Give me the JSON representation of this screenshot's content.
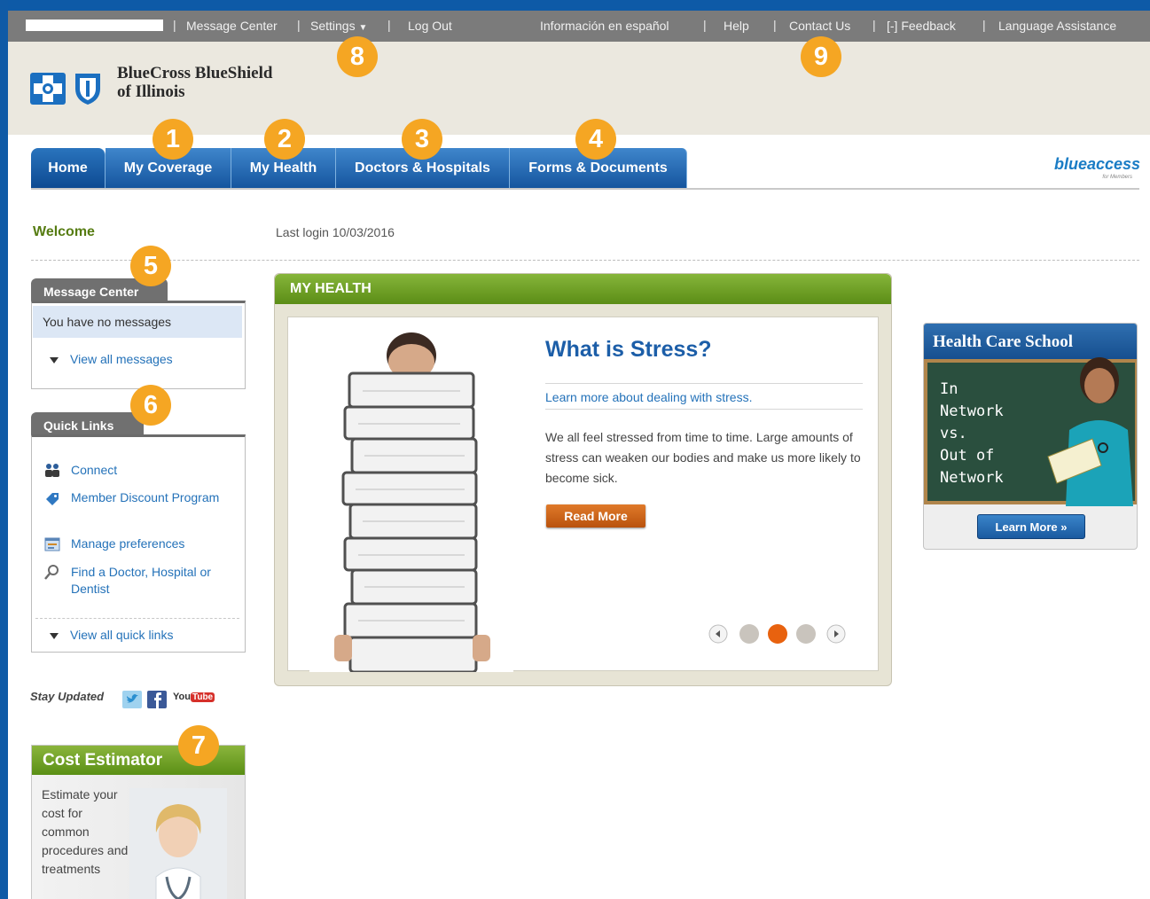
{
  "topbar": {
    "items": [
      "Message Center",
      "Settings",
      "Log Out",
      "Información en español",
      "Help",
      "Contact Us",
      "[-] Feedback",
      "Language Assistance"
    ]
  },
  "brand": {
    "line1": "BlueCross BlueShield",
    "line2": "of Illinois"
  },
  "nav": {
    "tabs": [
      "Home",
      "My Coverage",
      "My Health",
      "Doctors & Hospitals",
      "Forms & Documents"
    ]
  },
  "blueaccess": {
    "logo": "blueaccess",
    "sub": "for Members"
  },
  "welcome": {
    "label": "Welcome",
    "last_login": "Last login 10/03/2016"
  },
  "message_center": {
    "title": "Message Center",
    "status": "You have no messages",
    "view_all": "View all messages"
  },
  "quick_links": {
    "title": "Quick Links",
    "items": [
      {
        "label": "Connect",
        "icon": "people-icon"
      },
      {
        "label": "Member Discount Program",
        "icon": "tag-icon"
      },
      {
        "label": "Manage preferences",
        "icon": "settings-window-icon"
      },
      {
        "label": "Find a Doctor, Hospital or Dentist",
        "icon": "magnifier-icon"
      }
    ],
    "view_all": "View all quick links"
  },
  "social": {
    "label": "Stay Updated",
    "youtube": "YouTube"
  },
  "cost_estimator": {
    "title": "Cost Estimator",
    "text": "Estimate your cost for common procedures and treatments"
  },
  "my_health": {
    "header": "MY HEALTH",
    "title": "What is Stress?",
    "link": "Learn more about dealing with stress.",
    "body": "We all feel stressed from time to time. Large amounts of stress can weaken our bodies and make us more likely to become sick.",
    "button": "Read More",
    "carousel_active_dot": 2,
    "carousel_dot_count": 3
  },
  "health_care_school": {
    "title": "Health Care School",
    "chalk_lines": [
      "In",
      "Network",
      "vs.",
      "Out of",
      "Network"
    ],
    "button": "Learn More »"
  },
  "badges": [
    "1",
    "2",
    "3",
    "4",
    "5",
    "6",
    "7",
    "8",
    "9"
  ],
  "colors": {
    "brand_blue": "#15559e",
    "green": "#5b8d16",
    "orange": "#f5a623",
    "link": "#2472b9"
  }
}
